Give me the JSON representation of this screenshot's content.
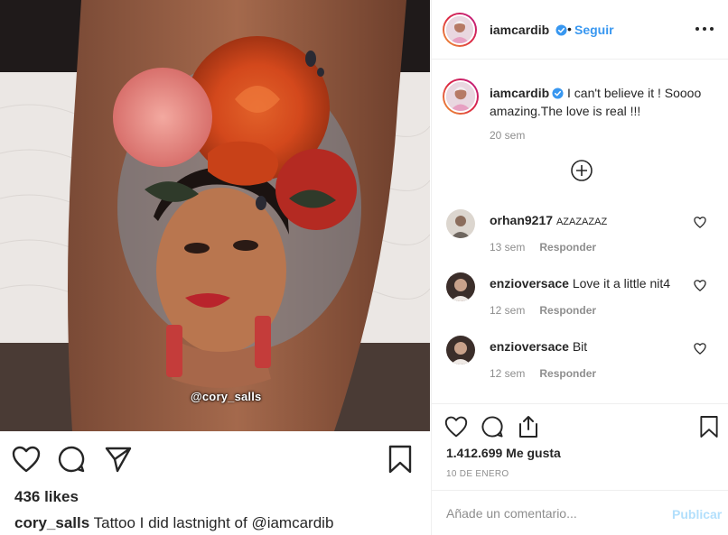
{
  "post": {
    "photo_watermark": "@cory_salls",
    "likes": "436 likes",
    "caption_user": "cory_salls",
    "caption_text": "Tattoo I did lastnight of @iamcardib"
  },
  "panel": {
    "header": {
      "username": "iamcardib",
      "separator": "•",
      "follow_label": "Seguir"
    },
    "caption": {
      "username": "iamcardib",
      "text": "I can't believe it ! Soooo amazing.The love is real !!!",
      "time": "20 sem"
    },
    "comments": [
      {
        "username": "orhan9217",
        "text": "AZAZAZAZ",
        "time": "13 sem",
        "reply_label": "Responder"
      },
      {
        "username": "enzioversace",
        "text": "Love it a little nit4",
        "time": "12 sem",
        "reply_label": "Responder"
      },
      {
        "username": "enzioversace",
        "text": "Bit",
        "time": "12 sem",
        "reply_label": "Responder"
      }
    ],
    "likes": "1.412.699 Me gusta",
    "date": "10 DE ENERO",
    "comment_placeholder": "Añade un comentario...",
    "publish_label": "Publicar"
  },
  "icons": {
    "like": "heart-icon",
    "comment": "comment-icon",
    "share": "send-icon",
    "save": "bookmark-icon",
    "more": "more-options-icon",
    "load_more": "plus-circle-icon",
    "verified": "verified-badge-icon"
  },
  "colors": {
    "link_blue": "#3897f0",
    "verified_blue": "#3897f0",
    "muted_text": "#8e8e8e",
    "publish_disabled": "#b2dffc"
  }
}
